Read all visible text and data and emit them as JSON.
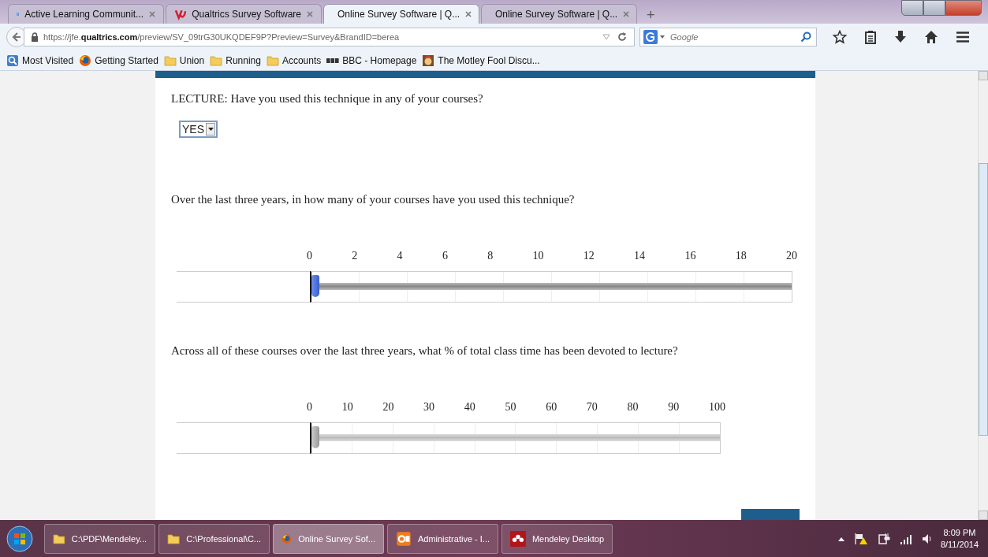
{
  "tabs": [
    {
      "kind": "docs",
      "title": "Active Learning Communit...",
      "selected": false
    },
    {
      "kind": "qualtrics",
      "title": "Qualtrics Survey Software",
      "selected": false
    },
    {
      "kind": "qualtrics",
      "title": "Online Survey Software | Q...",
      "selected": true
    },
    {
      "kind": "qualtrics",
      "title": "Online Survey Software | Q...",
      "selected": false
    }
  ],
  "new_tab": "+",
  "address_bar": {
    "url": "https://jfe.**qualtrics.com**/preview/SV_09trG30UKQDEF9P?Preview=Survey&BrandID=berea"
  },
  "search": {
    "placeholder": "Google"
  },
  "bookmarks": [
    {
      "kind": "places",
      "label": "Most Visited"
    },
    {
      "kind": "firefox",
      "label": "Getting Started"
    },
    {
      "kind": "folder",
      "label": "Union"
    },
    {
      "kind": "folder",
      "label": "Running"
    },
    {
      "kind": "folder",
      "label": "Accounts"
    },
    {
      "kind": "bbc",
      "label": "BBC - Homepage"
    },
    {
      "kind": "fool",
      "label": "The Motley Fool Discu..."
    }
  ],
  "survey": [
    {
      "kind": "dropdown",
      "question": "LECTURE: Have you used this technique in any of your courses?",
      "value": "YES"
    },
    {
      "kind": "slider",
      "question": "Over the last three years, in how many of your courses have you used this technique?",
      "ticks": [
        "0",
        "2",
        "4",
        "6",
        "8",
        "10",
        "12",
        "14",
        "16",
        "18",
        "20"
      ],
      "level": 0,
      "touched": true
    },
    {
      "kind": "slider",
      "question": "Across all of these courses over the last three years, what % of total class time has been devoted to lecture?",
      "ticks": [
        "0",
        "10",
        "20",
        "30",
        "40",
        "50",
        "60",
        "70",
        "80",
        "90",
        "100"
      ],
      "level": 0,
      "touched": false
    }
  ],
  "taskbar": [
    {
      "kind": "folder",
      "label": "C:\\PDF\\Mendeley...",
      "selected": false
    },
    {
      "kind": "folder",
      "label": "C:\\Professional\\C...",
      "selected": false
    },
    {
      "kind": "firefox",
      "label": "Online Survey Sof...",
      "selected": true
    },
    {
      "kind": "outlook",
      "label": "Administrative - I...",
      "selected": false
    },
    {
      "kind": "mendeley",
      "label": "Mendeley Desktop",
      "selected": false
    }
  ],
  "clock": {
    "time": "8:09 PM",
    "date": "8/11/2014"
  }
}
